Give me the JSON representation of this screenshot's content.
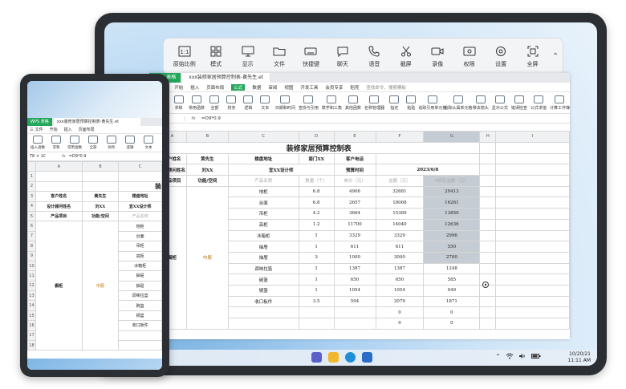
{
  "toolbar": {
    "items": [
      {
        "label": "原始比例",
        "icon": "aspect-ratio-icon"
      },
      {
        "label": "模式",
        "icon": "grid-mode-icon"
      },
      {
        "label": "显示",
        "icon": "display-icon"
      },
      {
        "label": "文件",
        "icon": "folder-icon"
      },
      {
        "label": "快捷键",
        "icon": "keyboard-icon"
      },
      {
        "label": "聊天",
        "icon": "chat-icon"
      },
      {
        "label": "语音",
        "icon": "phone-icon"
      },
      {
        "label": "截屏",
        "icon": "scissors-icon"
      },
      {
        "label": "录像",
        "icon": "video-icon"
      },
      {
        "label": "权限",
        "icon": "permission-icon"
      },
      {
        "label": "设置",
        "icon": "gear-icon"
      },
      {
        "label": "全屏",
        "icon": "fullscreen-icon"
      }
    ],
    "collapse_icon": "chevron-up-icon"
  },
  "spreadsheet": {
    "app_tab": "WPS 表格",
    "doc_tab": "xxx装修家居预算控制表-黄先生.et",
    "menu": [
      "三 文件",
      "开始",
      "插入",
      "页面布局",
      "公式",
      "数据",
      "审阅",
      "视图",
      "开发工具",
      "会员专享",
      "稻壳"
    ],
    "active_menu": "公式",
    "search": "查找命令、搜索模板",
    "ribbon": [
      "插入函数",
      "求和",
      "常用函数",
      "全部",
      "财务",
      "逻辑",
      "文本",
      "日期和时间",
      "查找与引用",
      "数学和三角",
      "其他函数",
      "名称管理器",
      "指定",
      "粘贴",
      "追踪引用单元格",
      "追踪从属单元格",
      "移去箭头",
      "显示公式",
      "错误检查",
      "公式求值",
      "计算工作簿"
    ],
    "cell_ref": "1C",
    "formula": "=D9*0.9",
    "col_headers": [
      "",
      "A",
      "B",
      "C",
      "D",
      "E",
      "F",
      "G",
      "H",
      "I"
    ],
    "title": "装修家居预算控制表",
    "header_rows": [
      [
        "客户姓名",
        "黄先生",
        "楼盘地址",
        "南门XX",
        "客户电话",
        "",
        ""
      ],
      [
        "设计顾问姓名",
        "刘XX",
        "宜XX设计师",
        "",
        "预算时间",
        "2023/6/8",
        ""
      ]
    ],
    "col_titles": [
      "产品项目",
      "功能/空间",
      "产品名称",
      "数量（个）",
      "单价（元）",
      "金额（元）",
      "9折后金额（元）"
    ],
    "group_a": "橱柜",
    "group_b": "中厨",
    "items": [
      [
        "地柜",
        "6.8",
        "4906",
        "32681",
        "29413"
      ],
      [
        "台面",
        "6.8",
        "2657",
        "18068",
        "16261"
      ],
      [
        "吊柜",
        "4.2",
        "3664",
        "15389",
        "13850"
      ],
      [
        "高柜",
        "1.2",
        "11700",
        "14040",
        "12636"
      ],
      [
        "冰箱柜",
        "1",
        "3329",
        "3329",
        "2996"
      ],
      [
        "抽屉",
        "1",
        "611",
        "611",
        "550"
      ],
      [
        "抽屉",
        "3",
        "1000",
        "3000",
        "2700"
      ],
      [
        "调味拉篮",
        "1",
        "1387",
        "1387",
        "1248"
      ],
      [
        "碗篮",
        "1",
        "650",
        "650",
        "585"
      ],
      [
        "锅篮",
        "1",
        "1054",
        "1054",
        "949"
      ],
      [
        "收口板件",
        "3.5",
        "594",
        "2079",
        "1871"
      ],
      [
        "",
        "",
        "",
        "0",
        "0"
      ],
      [
        "",
        "",
        "",
        "0",
        "0"
      ]
    ]
  },
  "taskbar": {
    "apps": [
      "teams-icon",
      "file-explorer-icon",
      "edge-icon",
      "store-icon"
    ],
    "time": "11:11 AM",
    "date": "10/20/21"
  },
  "phone": {
    "app_tab": "WPS 表格",
    "doc_tab": "xxx装修家居预算控制表-黄先生.et",
    "menu": [
      "三 文件",
      "开始",
      "插入",
      "页面布局"
    ],
    "ribbon": [
      "插入函数",
      "求和",
      "常用函数",
      "全部",
      "财务",
      "逻辑",
      "文本"
    ],
    "cell_ref": "T8 × 1C",
    "formula": "=D9*0.9",
    "col_headers": [
      "",
      "A",
      "B",
      "C"
    ],
    "title_partial": "装",
    "rows": [
      [
        "3",
        "客户姓名",
        "黄先生",
        "楼盘地址"
      ],
      [
        "4",
        "设计顾问姓名",
        "刘XX",
        "宜XX设计师"
      ],
      [
        "5",
        "产品项目",
        "功能/空间",
        "产品名称"
      ]
    ],
    "item_names": [
      "地柜",
      "台面",
      "吊柜",
      "高柜",
      "冰箱柜",
      "抽屉",
      "抽屉",
      "调味拉篮",
      "碗篮",
      "锅篮",
      "收口板件",
      "",
      ""
    ],
    "group_a": "橱柜",
    "group_b": "中厨"
  }
}
